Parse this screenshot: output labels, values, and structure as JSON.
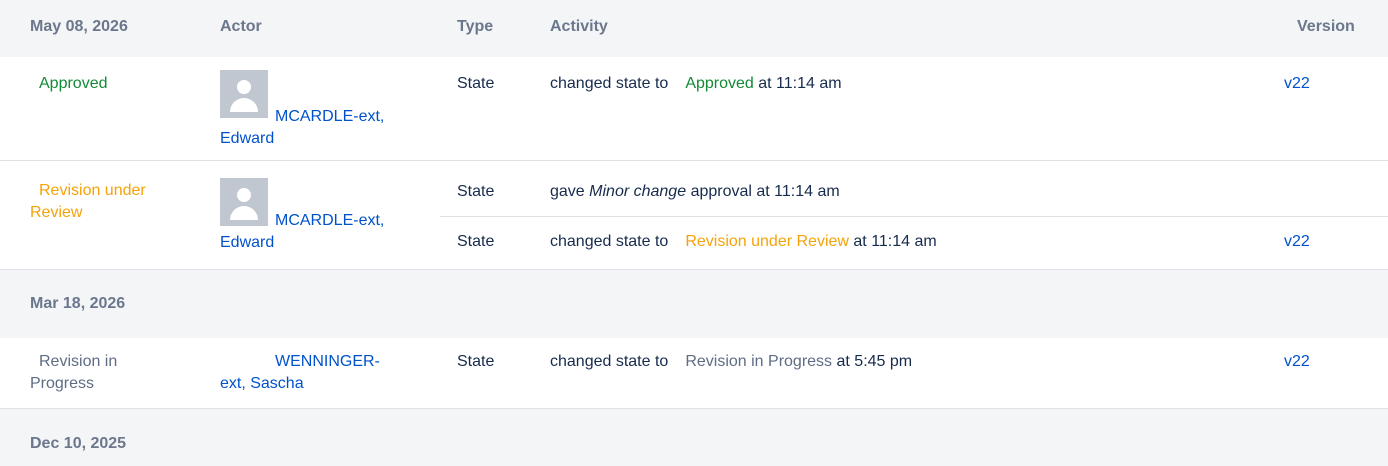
{
  "header": {
    "date": "May 08, 2026",
    "actor": "Actor",
    "type": "Type",
    "activity": "Activity",
    "version": "Version"
  },
  "group1": {
    "status": "Approved",
    "actor": "MCARDLE-ext, Edward",
    "actor_line1": "MCARDLE-ext,",
    "actor_line2": "Edward",
    "entries": [
      {
        "type": "State",
        "prefix": "changed state to",
        "state": "Approved",
        "suffix": "at 11:14 am",
        "version": "v22"
      }
    ]
  },
  "group2": {
    "status": "Revision under Review",
    "status_line1": "Revision under",
    "status_line2": "Review",
    "actor": "MCARDLE-ext, Edward",
    "actor_line1": "MCARDLE-ext,",
    "actor_line2": "Edward",
    "entries": [
      {
        "type": "State",
        "prefix": "gave",
        "em": "Minor change",
        "suffix": "approval at 11:14 am",
        "version": ""
      },
      {
        "type": "State",
        "prefix": "changed state to",
        "state": "Revision under Review",
        "suffix": "at 11:14 am",
        "version": "v22"
      }
    ]
  },
  "date2": "Mar 18, 2026",
  "group3": {
    "status": "Revision in Progress",
    "status_line1": "Revision in",
    "status_line2": "Progress",
    "actor_line1": "WENNINGER-",
    "actor_line2": "ext, Sascha",
    "entries": [
      {
        "type": "State",
        "prefix": "changed state to",
        "state": "Revision in Progress",
        "suffix": "at 5:45 pm",
        "version": "v22"
      }
    ]
  },
  "date3": "Dec 10, 2025",
  "colors": {
    "approved": "#138a36",
    "review": "#f5a30a",
    "progress": "#5e6c84",
    "link": "#0052cc"
  }
}
